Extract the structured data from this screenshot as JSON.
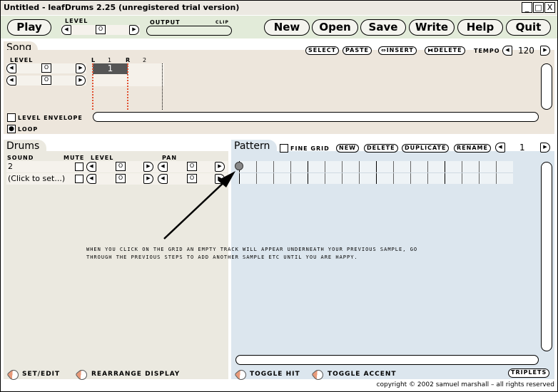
{
  "window": {
    "title": "Untitled - leafDrums 2.25 (unregistered trial version)",
    "minimize": "_",
    "maximize": "□",
    "close": "X"
  },
  "toolbar": {
    "play": "Play",
    "level_label": "LEVEL",
    "level_knob": "O",
    "output_label": "OUTPUT",
    "clip_label": "CLIP",
    "buttons": [
      "New",
      "Open",
      "Save",
      "Write",
      "Help",
      "Quit"
    ]
  },
  "song": {
    "tab": "Song",
    "level_label": "LEVEL",
    "markers": {
      "left": "L",
      "bar1": "1",
      "right": "R",
      "bar2": "2"
    },
    "block": "1",
    "select": "SELECT",
    "paste": "PASTE",
    "insert": "⇔INSERT",
    "delete": "⧓DELETE",
    "tempo_label": "TEMPO",
    "tempo": "120",
    "level_envelope": "LEVEL ENVELOPE",
    "loop": "LOOP",
    "loop_checked": true,
    "level_envelope_checked": false
  },
  "drums": {
    "tab": "Drums",
    "headers": {
      "sound": "SOUND",
      "mute": "MUTE",
      "level": "LEVEL",
      "pan": "PAN"
    },
    "rows": [
      {
        "sound": "2",
        "level": "O",
        "pan": "O"
      },
      {
        "sound": "(Click to set...)",
        "level": "O",
        "pan": "O"
      }
    ],
    "set_edit": "SET/EDIT",
    "rearrange": "REARRANGE DISPLAY"
  },
  "pattern": {
    "tab": "Pattern",
    "fine_grid": "FINE GRID",
    "new": "NEW",
    "delete": "DELETE",
    "duplicate": "DUPLICATE",
    "rename": "RENAME",
    "number": "1",
    "toggle_hit": "TOGGLE HIT",
    "toggle_accent": "TOGGLE ACCENT",
    "triplets": "TRIPLETS",
    "steps": 16
  },
  "annotation": {
    "line1": "WHEN YOU CLICK ON THE GRID AN EMPTY TRACK WILL APPEAR UNDERNEATH YOUR PREVIOUS SAMPLE, GO",
    "line2": "THROUGH THE PREVIOUS STEPS TO ADD ANOTHER SAMPLE ETC UNTIL YOU ARE HAPPY."
  },
  "copyright": "copyright © 2002 samuel marshall – all rights reserved",
  "colors": {
    "toolbar": "#e2ebd9",
    "song": "#ede6dc",
    "drums": "#ebe9e0",
    "pattern": "#dce6ee",
    "loop_marker": "#e05030"
  }
}
